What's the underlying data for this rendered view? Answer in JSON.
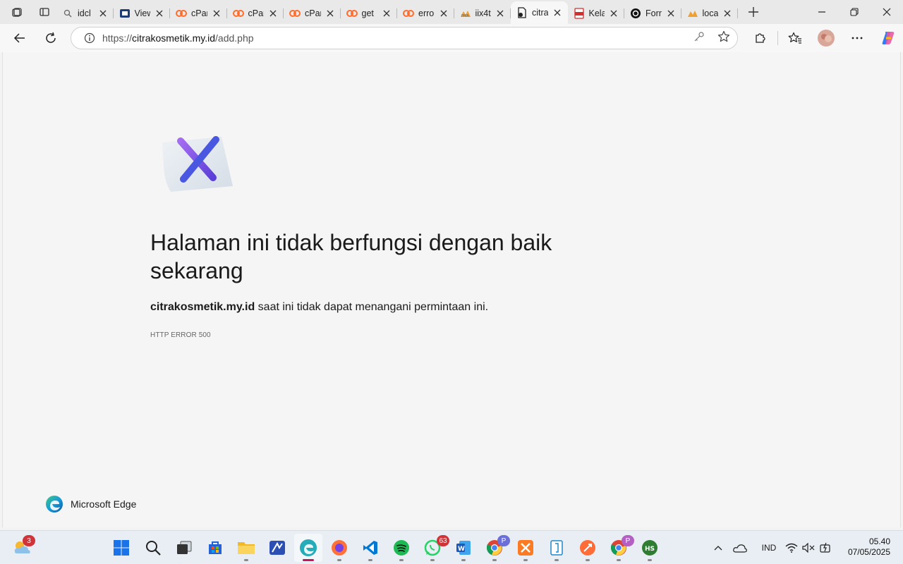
{
  "browser": {
    "tabs": [
      {
        "title": "idcl",
        "icon": "search-icon"
      },
      {
        "title": "View",
        "icon": "site-icon"
      },
      {
        "title": "cPan",
        "icon": "cpanel-icon"
      },
      {
        "title": "cPan",
        "icon": "cpanel-icon"
      },
      {
        "title": "cPan",
        "icon": "cpanel-icon"
      },
      {
        "title": "get",
        "icon": "cpanel-icon"
      },
      {
        "title": "erro",
        "icon": "cpanel-icon"
      },
      {
        "title": "iix4t",
        "icon": "phpmyadmin-icon"
      },
      {
        "title": "citra",
        "icon": "page-icon",
        "active": true
      },
      {
        "title": "Kela",
        "icon": "pdf-icon"
      },
      {
        "title": "Forr",
        "icon": "openai-icon"
      },
      {
        "title": "loca",
        "icon": "phpmyadmin-icon"
      }
    ],
    "address": {
      "prefix": "https://",
      "host": "citrakosmetik.my.id",
      "path": "/add.php"
    }
  },
  "error_page": {
    "title": "Halaman ini tidak berfungsi dengan baik sekarang",
    "host": "citrakosmetik.my.id",
    "message": " saat ini tidak dapat menangani permintaan ini.",
    "code": "HTTP ERROR 500",
    "brand": "Microsoft Edge"
  },
  "taskbar": {
    "weather_badge": "3",
    "whatsapp_badge": "63",
    "chrome_profile_badge": "P",
    "language": "IND",
    "time": "05.40",
    "date": "07/05/2025"
  },
  "colors": {
    "accent": "#c2185b",
    "error_x": "#7b4fe0",
    "cpanel": "#ff6c2c"
  }
}
